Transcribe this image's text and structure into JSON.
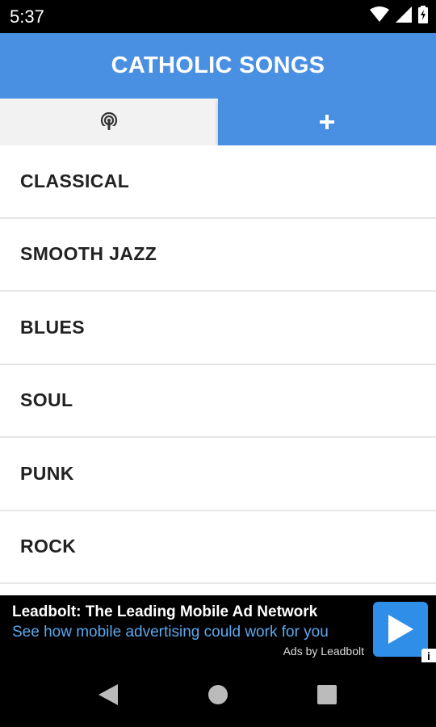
{
  "status": {
    "time": "5:37",
    "icons": [
      "wifi-icon",
      "signal-icon",
      "battery-icon"
    ]
  },
  "app": {
    "title": "CATHOLIC SONGS",
    "accent": "#4A90E2"
  },
  "tabs": [
    {
      "icon": "podcast-icon",
      "selected": false
    },
    {
      "icon": "plus-icon",
      "selected": true
    }
  ],
  "list": {
    "items": [
      {
        "label": "CLASSICAL"
      },
      {
        "label": "SMOOTH JAZZ"
      },
      {
        "label": "BLUES"
      },
      {
        "label": "SOUL"
      },
      {
        "label": "PUNK"
      },
      {
        "label": "ROCK"
      }
    ]
  },
  "ad": {
    "title": "Leadbolt: The Leading Mobile Ad Network",
    "subtitle": "See how mobile advertising could work for you",
    "by": "Ads by Leadbolt",
    "info": "i",
    "accent": "#2E8EE8"
  },
  "nav": {
    "buttons": [
      "back-icon",
      "home-icon",
      "recents-icon"
    ]
  }
}
